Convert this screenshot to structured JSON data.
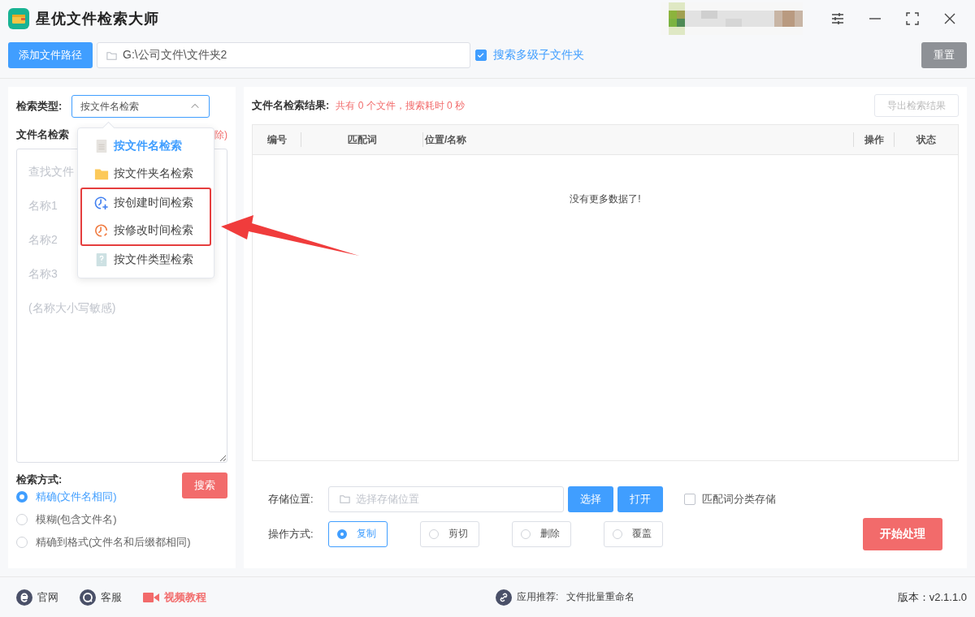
{
  "window": {
    "title": "星优文件检索大师"
  },
  "toolbar": {
    "add_button": "添加文件路径",
    "path": "G:\\公司文件\\文件夹2",
    "subfolders": {
      "label": "搜索多级子文件夹",
      "checked": true
    },
    "reset_button": "重置"
  },
  "left_panel": {
    "type_label": "检索类型:",
    "type_value": "按文件名检索",
    "terms_label": "文件名检索",
    "terms_note": "除)",
    "terms_placeholder": [
      "查找文件",
      "名称1",
      "名称2",
      "名称3",
      "(名称大小写敏感)"
    ],
    "mode_label": "检索方式:",
    "search_button": "搜索",
    "modes": [
      {
        "label": "精确(文件名相同)",
        "selected": true
      },
      {
        "label": "模糊(包含文件名)",
        "selected": false
      },
      {
        "label": "精确到格式(文件名和后缀都相同)",
        "selected": false
      }
    ]
  },
  "dropdown": {
    "items": [
      {
        "label": "按文件名检索",
        "kind": "file",
        "selected": true,
        "highlighted": false
      },
      {
        "label": "按文件夹名检索",
        "kind": "folder",
        "selected": false,
        "highlighted": false
      },
      {
        "label": "按创建时间检索",
        "kind": "created",
        "selected": false,
        "highlighted": true
      },
      {
        "label": "按修改时间检索",
        "kind": "modified",
        "selected": false,
        "highlighted": true
      },
      {
        "label": "按文件类型检索",
        "kind": "filetype",
        "selected": false,
        "highlighted": false
      }
    ]
  },
  "results": {
    "title": "文件名检索结果:",
    "summary": "共有 0 个文件，搜索耗时 0 秒",
    "export_button": "导出检索结果",
    "columns": [
      "编号",
      "匹配词",
      "位置/名称",
      "操作",
      "状态"
    ],
    "empty": "没有更多数据了!"
  },
  "storage": {
    "label": "存储位置:",
    "placeholder": "选择存储位置",
    "choose_button": "选择",
    "open_button": "打开",
    "classify": {
      "label": "匹配词分类存储",
      "checked": false
    }
  },
  "operation": {
    "label": "操作方式:",
    "options": [
      {
        "label": "复制",
        "selected": true
      },
      {
        "label": "剪切",
        "selected": false
      },
      {
        "label": "删除",
        "selected": false
      },
      {
        "label": "覆盖",
        "selected": false
      }
    ]
  },
  "start_button": "开始处理",
  "footer": {
    "links": [
      {
        "label": "官网",
        "kind": "web"
      },
      {
        "label": "客服",
        "kind": "chat"
      },
      {
        "label": "视频教程",
        "kind": "video"
      }
    ],
    "recommend_label": "应用推荐:",
    "recommend_app": "文件批量重命名",
    "version": "版本：v2.1.1.0"
  }
}
